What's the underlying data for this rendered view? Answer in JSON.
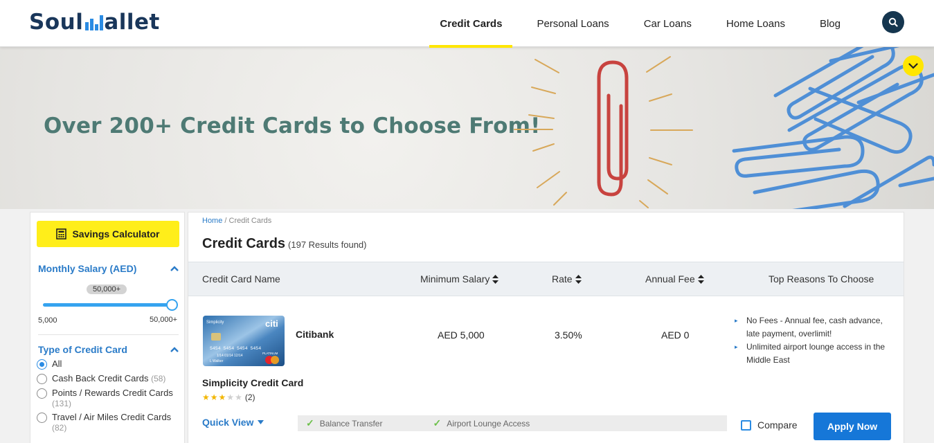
{
  "header": {
    "logo_text_left": "Soul",
    "logo_text_right": "allet",
    "nav": [
      {
        "label": "Credit Cards",
        "active": true
      },
      {
        "label": "Personal Loans",
        "active": false
      },
      {
        "label": "Car Loans",
        "active": false
      },
      {
        "label": "Home Loans",
        "active": false
      },
      {
        "label": "Blog",
        "active": false
      }
    ],
    "search_icon": "search-icon"
  },
  "hero": {
    "title": "Over 200+ Credit Cards to Choose From!",
    "collapse_icon": "chevron-down-icon"
  },
  "sidebar": {
    "calculator_label": "Savings Calculator",
    "calculator_icon": "calculator-icon",
    "salary": {
      "title": "Monthly Salary (AED)",
      "selected_label": "50,000+",
      "min_label": "5,000",
      "max_label": "50,000+",
      "level": 1.0
    },
    "card_type": {
      "title": "Type of Credit Card",
      "options": [
        {
          "label": "All",
          "count": "",
          "selected": true
        },
        {
          "label": "Cash Back Credit Cards",
          "count": "(58)",
          "selected": false
        },
        {
          "label": "Points / Rewards Credit Cards",
          "count": "(131)",
          "selected": false
        },
        {
          "label": "Travel / Air Miles Credit Cards",
          "count": "(82)",
          "selected": false
        }
      ]
    }
  },
  "main": {
    "breadcrumb": {
      "home": "Home",
      "separator": "/",
      "current": "Credit Cards"
    },
    "title": "Credit Cards",
    "results": "(197 Results found)",
    "columns": {
      "name": "Credit Card Name",
      "min_salary": "Minimum Salary",
      "rate": "Rate",
      "annual_fee": "Annual Fee",
      "reasons": "Top Reasons To Choose"
    },
    "row": {
      "bank": "Citibank",
      "card_name": "Simplicity Credit Card",
      "min_salary": "AED 5,000",
      "rate": "3.50%",
      "annual_fee": "AED 0",
      "rating": 3,
      "rating_max": 5,
      "review_count": "(2)",
      "reasons": [
        "No Fees - Annual fee, cash advance, late payment, overlimit!",
        "Unlimited airport lounge access in the Middle East"
      ],
      "card_image": {
        "brand_small": "Simplicity",
        "brand": "citi",
        "number": "5454 5454 5454 5454",
        "expiry": "1/14 01/14 12/14",
        "holder": "L Walker",
        "tier": "PLATINUM",
        "network": "MasterCard"
      },
      "quick_view": "Quick View",
      "features": [
        "Balance Transfer",
        "Airport Lounge Access"
      ],
      "compare_label": "Compare",
      "apply_label": "Apply Now"
    }
  },
  "colors": {
    "brand_navy": "#19365a",
    "accent_yellow": "#ffe600",
    "link_blue": "#2a7bc8",
    "button_blue": "#1677d8",
    "hero_text": "#4e7a74"
  }
}
